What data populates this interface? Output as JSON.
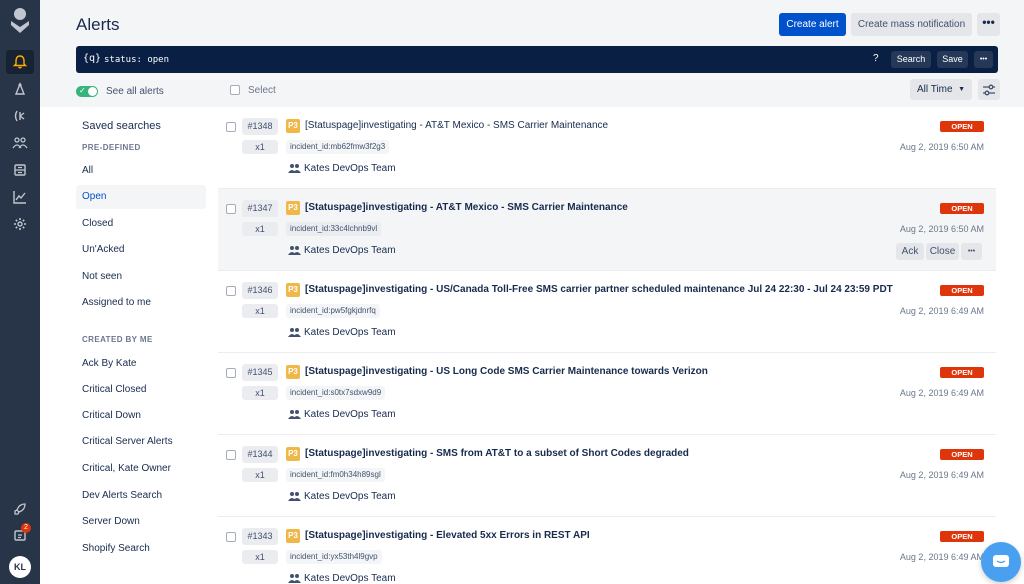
{
  "header": {
    "title": "Alerts",
    "create_alert": "Create alert",
    "mass_notification": "Create mass notification",
    "more": "•••"
  },
  "search": {
    "prefix": "{q}",
    "query": "status: open",
    "help": "?",
    "search_label": "Search",
    "save_label": "Save",
    "more": "•••"
  },
  "toolbar": {
    "see_all": "See all alerts",
    "select": "Select",
    "time_filter": "All Time"
  },
  "sidebar": {
    "title": "Saved searches",
    "predefined_label": "PRE-DEFINED",
    "predefined": [
      "All",
      "Open",
      "Closed",
      "Un'Acked",
      "Not seen",
      "Assigned to me"
    ],
    "created_label": "CREATED BY ME",
    "created": [
      "Ack By Kate",
      "Critical Closed",
      "Critical Down",
      "Critical Server Alerts",
      "Critical, Kate Owner",
      "Dev Alerts Search",
      "Server Down",
      "Shopify Search"
    ]
  },
  "alerts": [
    {
      "id": "#1348",
      "count": "x1",
      "priority": "P3",
      "message": "[Statuspage]investigating - AT&T Mexico - SMS Carrier Maintenance",
      "tag": "incident_id:mb62fmw3f2g3",
      "team": "Kates DevOps Team",
      "status": "OPEN",
      "time": "Aug 2, 2019 6:50 AM"
    },
    {
      "id": "#1347",
      "count": "x1",
      "priority": "P3",
      "message": "[Statuspage]investigating - AT&T Mexico - SMS Carrier Maintenance",
      "tag": "incident_id:33c4lchnb9vl",
      "team": "Kates DevOps Team",
      "status": "OPEN",
      "time": "Aug 2, 2019 6:50 AM"
    },
    {
      "id": "#1346",
      "count": "x1",
      "priority": "P3",
      "message": "[Statuspage]investigating - US/Canada Toll-Free SMS carrier partner scheduled maintenance Jul 24 22:30 - Jul 24 23:59 PDT",
      "tag": "incident_id:pw5fgkjdnrfq",
      "team": "Kates DevOps Team",
      "status": "OPEN",
      "time": "Aug 2, 2019 6:49 AM"
    },
    {
      "id": "#1345",
      "count": "x1",
      "priority": "P3",
      "message": "[Statuspage]investigating - US Long Code SMS Carrier Maintenance towards Verizon",
      "tag": "incident_id:s0tx7sdxw9d9",
      "team": "Kates DevOps Team",
      "status": "OPEN",
      "time": "Aug 2, 2019 6:49 AM"
    },
    {
      "id": "#1344",
      "count": "x1",
      "priority": "P3",
      "message": "[Statuspage]investigating - SMS from AT&T to a subset of Short Codes degraded",
      "tag": "incident_id:fm0h34h89sgl",
      "team": "Kates DevOps Team",
      "status": "OPEN",
      "time": "Aug 2, 2019 6:49 AM"
    },
    {
      "id": "#1343",
      "count": "x1",
      "priority": "P3",
      "message": "[Statuspage]investigating - Elevated 5xx Errors in REST API",
      "tag": "incident_id:yx53th4l9gvp",
      "team": "Kates DevOps Team",
      "status": "OPEN",
      "time": "Aug 2, 2019 6:49 AM"
    }
  ],
  "row_actions": {
    "ack": "Ack",
    "close": "Close",
    "more": "•••"
  },
  "user": {
    "initials": "KL",
    "notification_count": "2"
  },
  "colors": {
    "primary": "#0052CC",
    "open_status": "#DE350B",
    "priority_p3": "#F0B849",
    "nav_bg": "#283447"
  }
}
